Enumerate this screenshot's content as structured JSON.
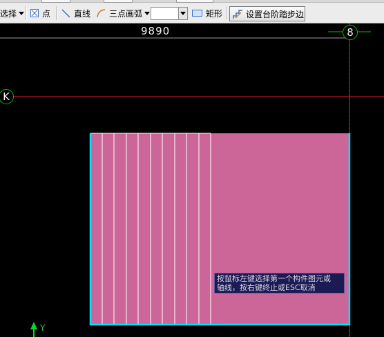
{
  "toolbar": {
    "select_label": "选择",
    "point_label": "点",
    "line_label": "直线",
    "arc_label": "三点画弧",
    "combo_value": "",
    "rect_label": "矩形",
    "set_step_button": "设置台阶踏步边"
  },
  "canvas": {
    "dimension_text": "9890",
    "axis_8": "8",
    "axis_k": "K",
    "y_axis_label": "Y",
    "tooltip_line1": "按鼠标左键选择第一个构件图元或",
    "tooltip_line2": "轴线，按右键终止或ESC取消",
    "colors": {
      "background": "#000000",
      "slab_fill": "#cc6699",
      "slab_edge": "#00e5ff",
      "grid_red": "#e02020",
      "grid_green": "#00c000"
    }
  }
}
